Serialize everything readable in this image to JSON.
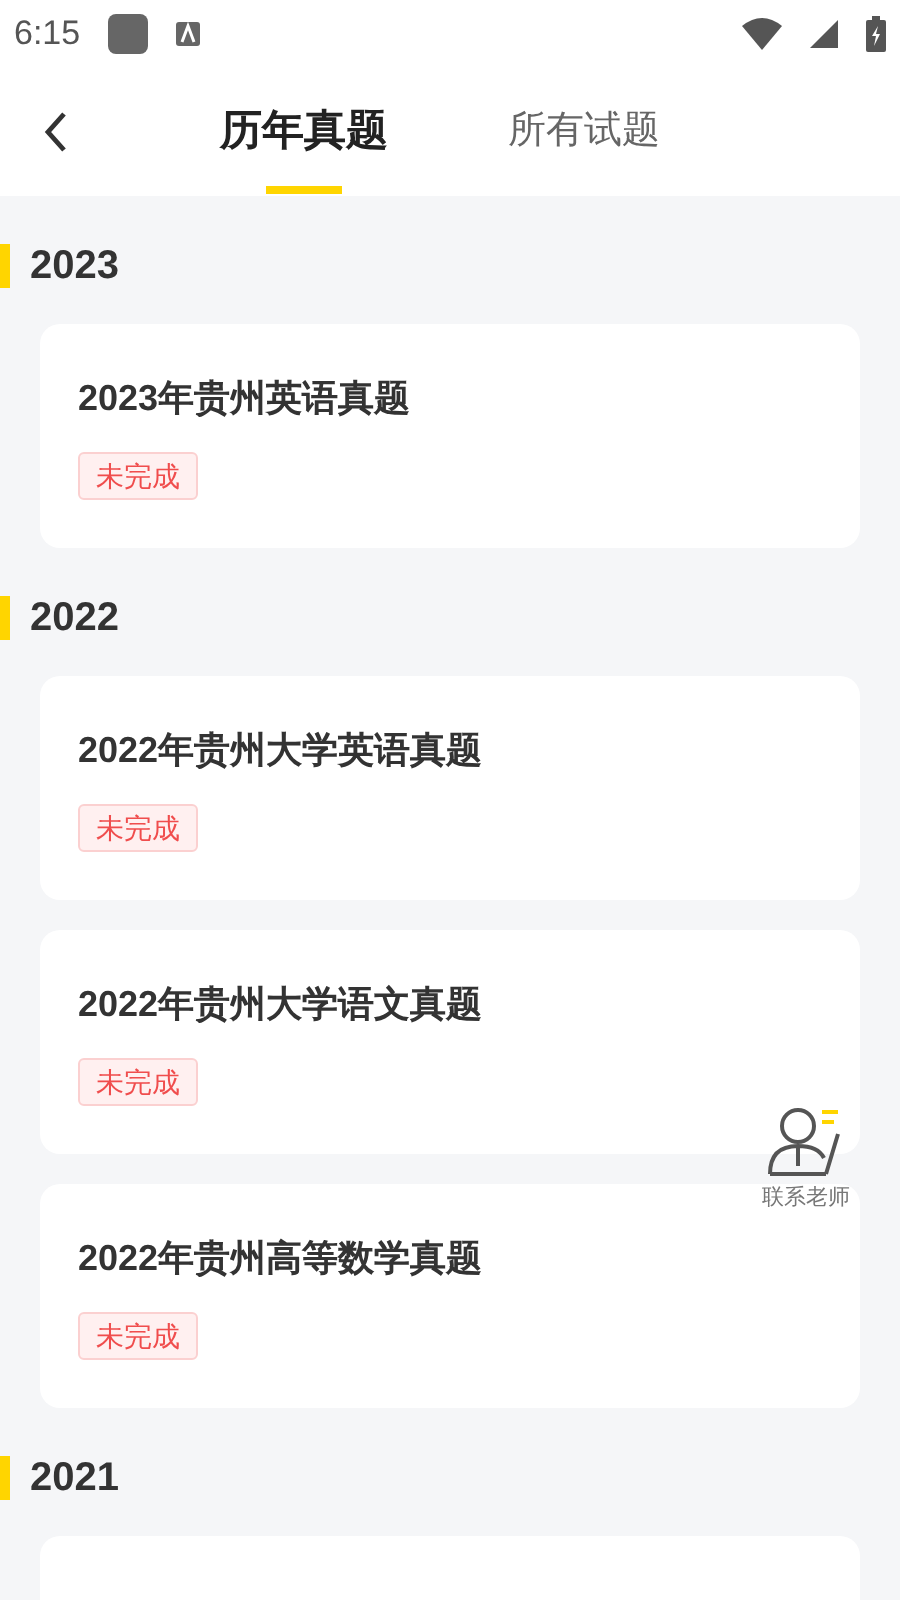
{
  "status_bar": {
    "time": "6:15"
  },
  "tabs": [
    {
      "label": "历年真题",
      "selected": true
    },
    {
      "label": "所有试题",
      "selected": false
    }
  ],
  "sections": [
    {
      "year": "2023",
      "papers": [
        {
          "kind": "full",
          "title": "2023年贵州英语真题",
          "status": "未完成"
        }
      ]
    },
    {
      "year": "2022",
      "papers": [
        {
          "kind": "full",
          "title": "2022年贵州大学英语真题",
          "status": "未完成"
        },
        {
          "kind": "full",
          "title": "2022年贵州大学语文真题",
          "status": "未完成"
        },
        {
          "kind": "full",
          "title": "2022年贵州高等数学真题",
          "status": "未完成"
        }
      ]
    },
    {
      "year": "2021",
      "papers": [
        {
          "kind": "partial"
        }
      ]
    }
  ],
  "contact": {
    "label": "联系老师"
  }
}
